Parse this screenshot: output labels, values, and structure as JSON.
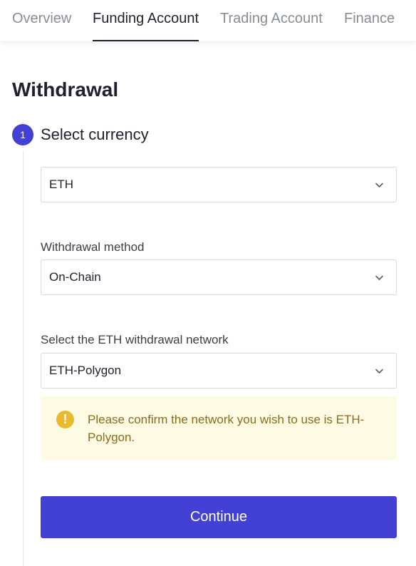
{
  "tabs": [
    {
      "label": "Overview",
      "active": false
    },
    {
      "label": "Funding Account",
      "active": true
    },
    {
      "label": "Trading Account",
      "active": false
    },
    {
      "label": "Finance",
      "active": false
    }
  ],
  "page": {
    "title": "Withdrawal"
  },
  "step": {
    "number": "1",
    "title": "Select currency"
  },
  "currency_select": {
    "value": "ETH",
    "icon": "chevron-down-icon"
  },
  "method": {
    "label": "Withdrawal method",
    "value": "On-Chain",
    "icon": "chevron-down-icon"
  },
  "network": {
    "label": "Select the ETH withdrawal network",
    "value": "ETH-Polygon",
    "icon": "chevron-down-icon"
  },
  "notice": {
    "icon_glyph": "!",
    "icon": "warning-icon",
    "text": "Please confirm the network you wish to use is ETH-Polygon.",
    "background_color": "#fdfbe3",
    "icon_color": "#e9bb2c"
  },
  "continue_button": {
    "label": "Continue"
  },
  "colors": {
    "accent": "#4340d6",
    "text": "#1f2130",
    "muted": "#8a8c96"
  }
}
